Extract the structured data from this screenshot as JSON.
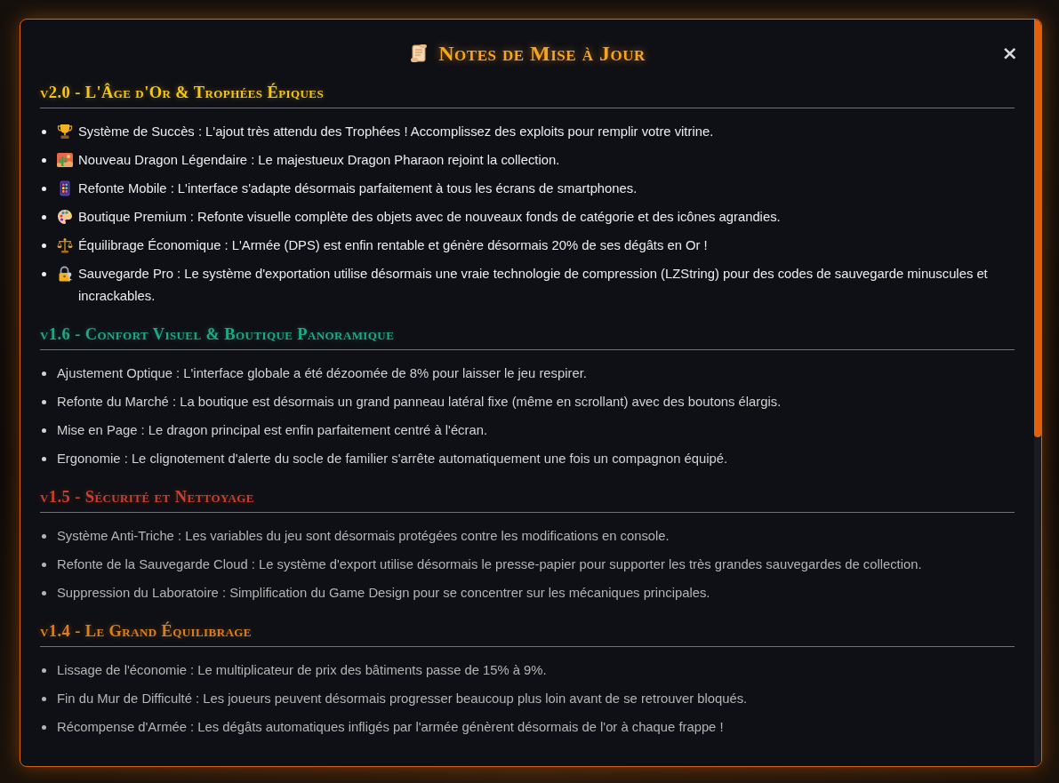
{
  "modal": {
    "title": "Notes de Mise à Jour",
    "close_label": "×"
  },
  "sections": [
    {
      "heading": "v2.0 - L'Âge d'Or & Trophées Épiques",
      "color": "#f5c518",
      "kind": "latest",
      "items": [
        "Système de Succès : L'ajout très attendu des Trophées ! Accomplissez des exploits pour remplir votre vitrine.",
        "Nouveau Dragon Légendaire : Le majestueux Dragon Pharaon rejoint la collection.",
        "Refonte Mobile : L'interface s'adapte désormais parfaitement à tous les écrans de smartphones.",
        "Boutique Premium : Refonte visuelle complète des objets avec de nouveaux fonds de catégorie et des icônes agrandies.",
        "Équilibrage Économique : L'Armée (DPS) est enfin rentable et génère désormais 20% de ses dégâts en Or !",
        "Sauvegarde Pro : Le système d'exportation utilise désormais une vraie technologie de compression (LZString) pour des codes de sauvegarde minuscules et incrackables."
      ]
    },
    {
      "heading": "v1.6 - Confort Visuel & Boutique Panoramique",
      "color": "#1fa882",
      "kind": "recent",
      "items": [
        "Ajustement Optique : L'interface globale a été dézoomée de 8% pour laisser le jeu respirer.",
        "Refonte du Marché : La boutique est désormais un grand panneau latéral fixe (même en scrollant) avec des boutons élargis.",
        "Mise en Page : Le dragon principal est enfin parfaitement centré à l'écran.",
        "Ergonomie : Le clignotement d'alerte du socle de familier s'arrête automatiquement une fois un compagnon équipé."
      ]
    },
    {
      "heading": "v1.5 - Sécurité et Nettoyage",
      "color": "#c8402e",
      "kind": "old",
      "items": [
        "Système Anti-Triche : Les variables du jeu sont désormais protégées contre les modifications en console.",
        "Refonte de la Sauvegarde Cloud : Le système d'export utilise désormais le presse-papier pour supporter les très grandes sauvegardes de collection.",
        "Suppression du Laboratoire : Simplification du Game Design pour se concentrer sur les mécaniques principales."
      ]
    },
    {
      "heading": "v1.4 - Le Grand Équilibrage",
      "color": "#d9801e",
      "kind": "old",
      "items": [
        "Lissage de l'économie : Le multiplicateur de prix des bâtiments passe de 15% à 9%.",
        "Fin du Mur de Difficulté : Les joueurs peuvent désormais progresser beaucoup plus loin avant de se retrouver bloqués.",
        "Récompense d'Armée : Les dégâts automatiques infligés par l'armée génèrent désormais de l'or à chaque frappe !"
      ]
    }
  ]
}
